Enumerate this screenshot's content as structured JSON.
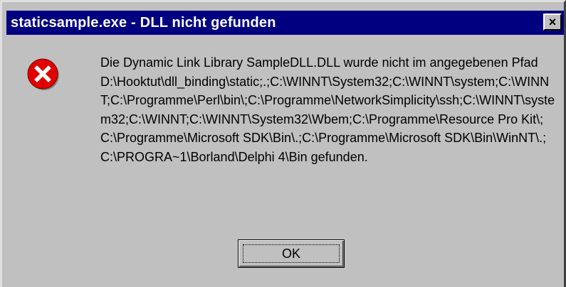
{
  "window": {
    "title": "staticsample.exe - DLL nicht gefunden",
    "close_label": "×"
  },
  "icon": {
    "name": "error-icon",
    "color": "#e00000"
  },
  "message": {
    "text": "Die Dynamic Link Library SampleDLL.DLL wurde nicht im angegebenen Pfad D:\\Hooktut\\dll_binding\\static;.;C:\\WINNT\\System32;C:\\WINNT\\system;C:\\WINNT;C:\\Programme\\Perl\\bin\\;C:\\Programme\\NetworkSimplicity\\ssh;C:\\WINNT\\system32;C:\\WINNT;C:\\WINNT\\System32\\Wbem;C:\\Programme\\Resource Pro Kit\\;C:\\Programme\\Microsoft SDK\\Bin\\.;C:\\Programme\\Microsoft SDK\\Bin\\WinNT\\.;C:\\PROGRA~1\\Borland\\Delphi 4\\Bin gefunden."
  },
  "buttons": {
    "ok_label": "OK"
  }
}
